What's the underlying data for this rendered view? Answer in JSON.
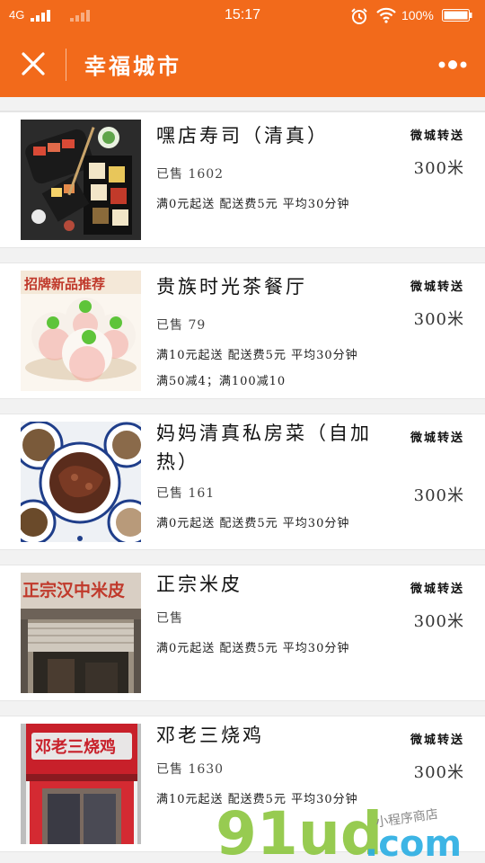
{
  "status_bar": {
    "network": "4G",
    "time": "15:17",
    "battery": "100%"
  },
  "header": {
    "title": "幸福城市"
  },
  "shops": [
    {
      "name": "嘿店寿司（清真）",
      "sold": "已售 1602",
      "rules": [
        "满0元起送 配送费5元 平均30分钟"
      ],
      "delivery_tag": "微城转送",
      "distance": "300米"
    },
    {
      "name": "贵族时光茶餐厅",
      "sold": "已售 79",
      "rules": [
        "满10元起送 配送费5元 平均30分钟",
        "满50减4；满100减10"
      ],
      "delivery_tag": "微城转送",
      "distance": "300米",
      "image_sign": "招牌新品推荐"
    },
    {
      "name": "妈妈清真私房菜（自加热）",
      "sold": "已售 161",
      "rules": [
        "满0元起送 配送费5元 平均30分钟"
      ],
      "delivery_tag": "微城转送",
      "distance": "300米"
    },
    {
      "name": "正宗米皮",
      "sold": "已售",
      "rules": [
        "满0元起送 配送费5元 平均30分钟"
      ],
      "delivery_tag": "微城转送",
      "distance": "300米",
      "image_sign": "正宗汉中米皮"
    },
    {
      "name": "邓老三烧鸡",
      "sold": "已售 1630",
      "rules": [
        "满10元起送 配送费5元 平均30分钟"
      ],
      "delivery_tag": "微城转送",
      "distance": "300米",
      "image_sign": "邓老三烧鸡"
    }
  ],
  "watermark": {
    "logo": "91ud.com",
    "tagline": "小程序商店"
  },
  "colors": {
    "header": "#f26a1b",
    "watermark_green": "#8cc63f",
    "watermark_blue": "#29aee3"
  }
}
